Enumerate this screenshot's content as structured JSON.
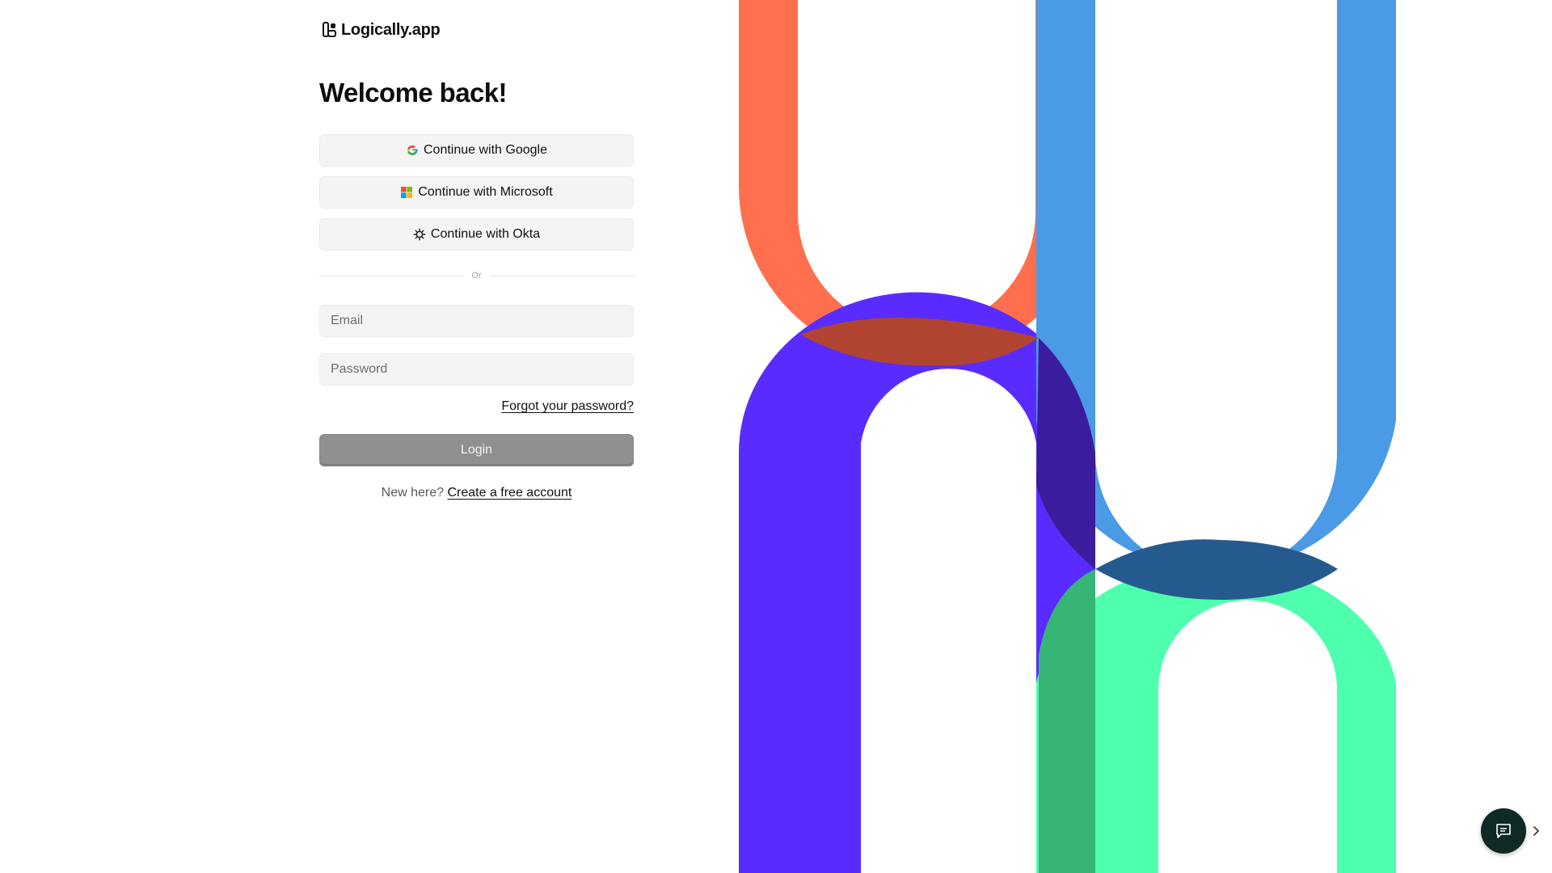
{
  "brand": {
    "name": "Logically.app"
  },
  "login": {
    "title": "Welcome back!",
    "sso": {
      "google_label": "Continue with Google",
      "microsoft_label": "Continue with Microsoft",
      "okta_label": "Continue with Okta"
    },
    "divider_text": "Or",
    "email_placeholder": "Email",
    "password_placeholder": "Password",
    "forgot_label": "Forgot your password?",
    "login_label": "Login",
    "signup_prompt": "New here?",
    "signup_link": "Create a free account"
  },
  "icons": {
    "logo": "logo-icon",
    "google": "google-icon",
    "microsoft": "microsoft-icon",
    "okta": "okta-icon",
    "chat": "chat-icon",
    "toggle": "chevron-right-icon"
  },
  "colors": {
    "background": "#ffffff",
    "button_bg": "#f4f4f4",
    "login_bg": "#8f908f",
    "art_orange": "#ff6f4e",
    "art_violet": "#5a2bff",
    "art_blue": "#4a9ae6",
    "art_green": "#4effae",
    "chat_bg": "#0f2a24"
  }
}
